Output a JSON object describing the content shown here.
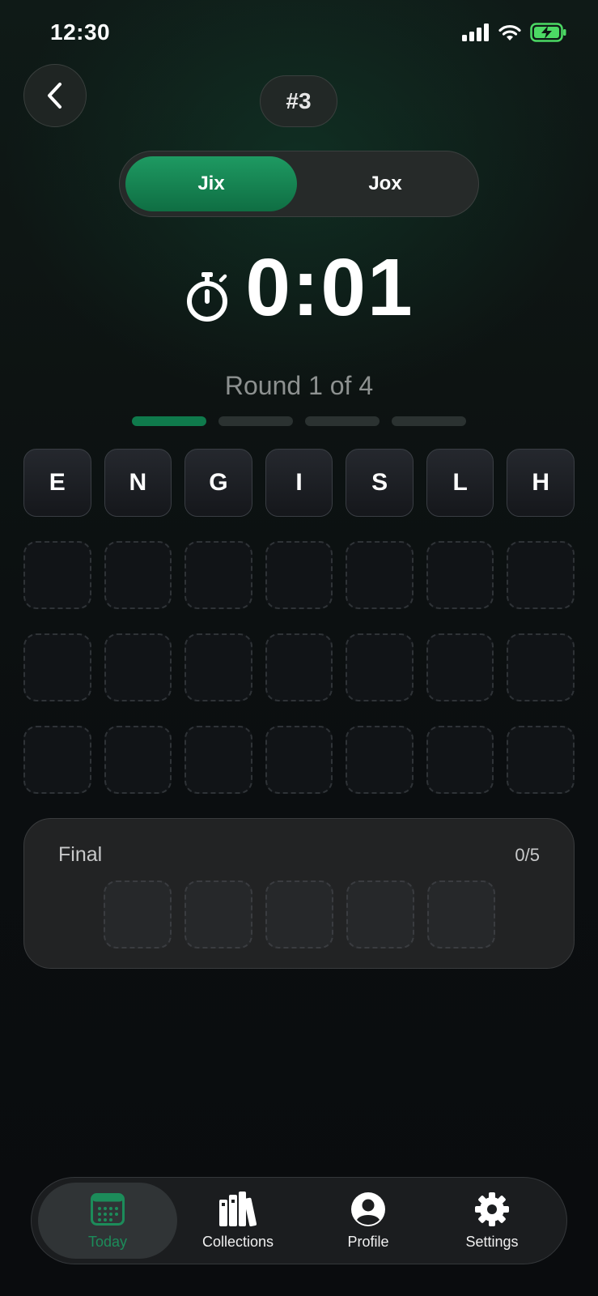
{
  "status_bar": {
    "time": "12:30"
  },
  "header": {
    "puzzle_number": "#3"
  },
  "mode_toggle": {
    "options": [
      "Jix",
      "Jox"
    ],
    "selected": "Jix"
  },
  "timer": {
    "value": "0:01"
  },
  "round": {
    "label": "Round 1 of 4",
    "current": 1,
    "total": 4
  },
  "letters": [
    "E",
    "N",
    "G",
    "I",
    "S",
    "L",
    "H"
  ],
  "final": {
    "label": "Final",
    "count": "0/5"
  },
  "tabs": [
    {
      "label": "Today",
      "icon": "calendar-icon",
      "active": true
    },
    {
      "label": "Collections",
      "icon": "books-icon",
      "active": false
    },
    {
      "label": "Profile",
      "icon": "profile-icon",
      "active": false
    },
    {
      "label": "Settings",
      "icon": "gear-icon",
      "active": false
    }
  ],
  "colors": {
    "accent": "#1c8c5a",
    "toggle_active": "#178a55",
    "background": "#0b0e10"
  }
}
